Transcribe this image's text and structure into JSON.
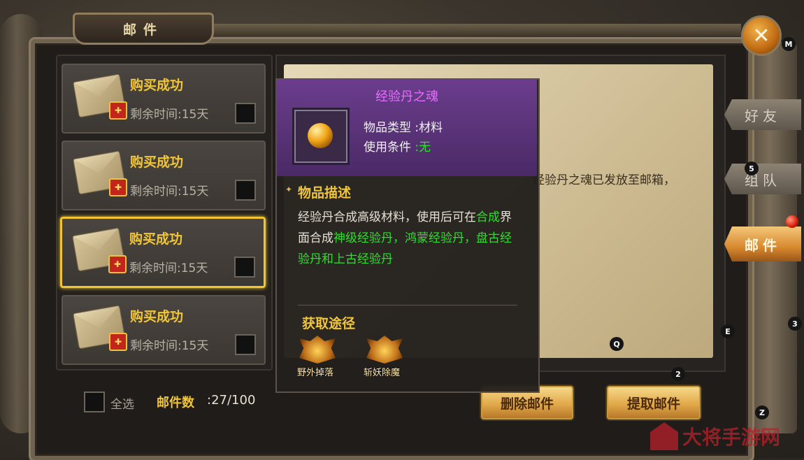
{
  "window": {
    "title": "邮件",
    "close_icon": "close-icon"
  },
  "mail_list": [
    {
      "title": "购买成功",
      "time": "剩余时间:15天",
      "selected": false
    },
    {
      "title": "购买成功",
      "time": "剩余时间:15天",
      "selected": false
    },
    {
      "title": "购买成功",
      "time": "剩余时间:15天",
      "selected": true
    },
    {
      "title": "购买成功",
      "time": "剩余时间:15天",
      "selected": false
    }
  ],
  "footer": {
    "select_all_label": "全选",
    "mail_count_label": "邮件数",
    "mail_count_value": ":27/100",
    "delete_button": "删除邮件",
    "extract_button": "提取邮件"
  },
  "letter": {
    "text": "经验丹之魂已发放至邮箱，"
  },
  "side_tabs": [
    {
      "label": "好友",
      "active": false
    },
    {
      "label": "组队",
      "active": false
    },
    {
      "label": "邮件",
      "active": true,
      "badge_color": "#d91b0b"
    }
  ],
  "tooltip": {
    "item_name": "经验丹之魂",
    "item_name_color": "#e66cff",
    "type_label": "物品类型",
    "type_value": ":材料",
    "condition_label": "使用条件",
    "condition_value": ":无",
    "desc_title": "物品描述",
    "desc_part1": "经验丹合成高级材料，使用后可在",
    "desc_green1": "合成",
    "desc_part2": "界面合成",
    "desc_green2": "神级经验丹，鸿蒙经验丹，盘古经验丹和上古经验丹",
    "source_title": "获取途径",
    "sources": [
      {
        "label": "野外掉落"
      },
      {
        "label": "斩妖除魔"
      }
    ]
  },
  "overlay_markers": [
    "M",
    "5",
    "E",
    "3",
    "Q",
    "2",
    "Z"
  ],
  "watermark": "大将手游网"
}
